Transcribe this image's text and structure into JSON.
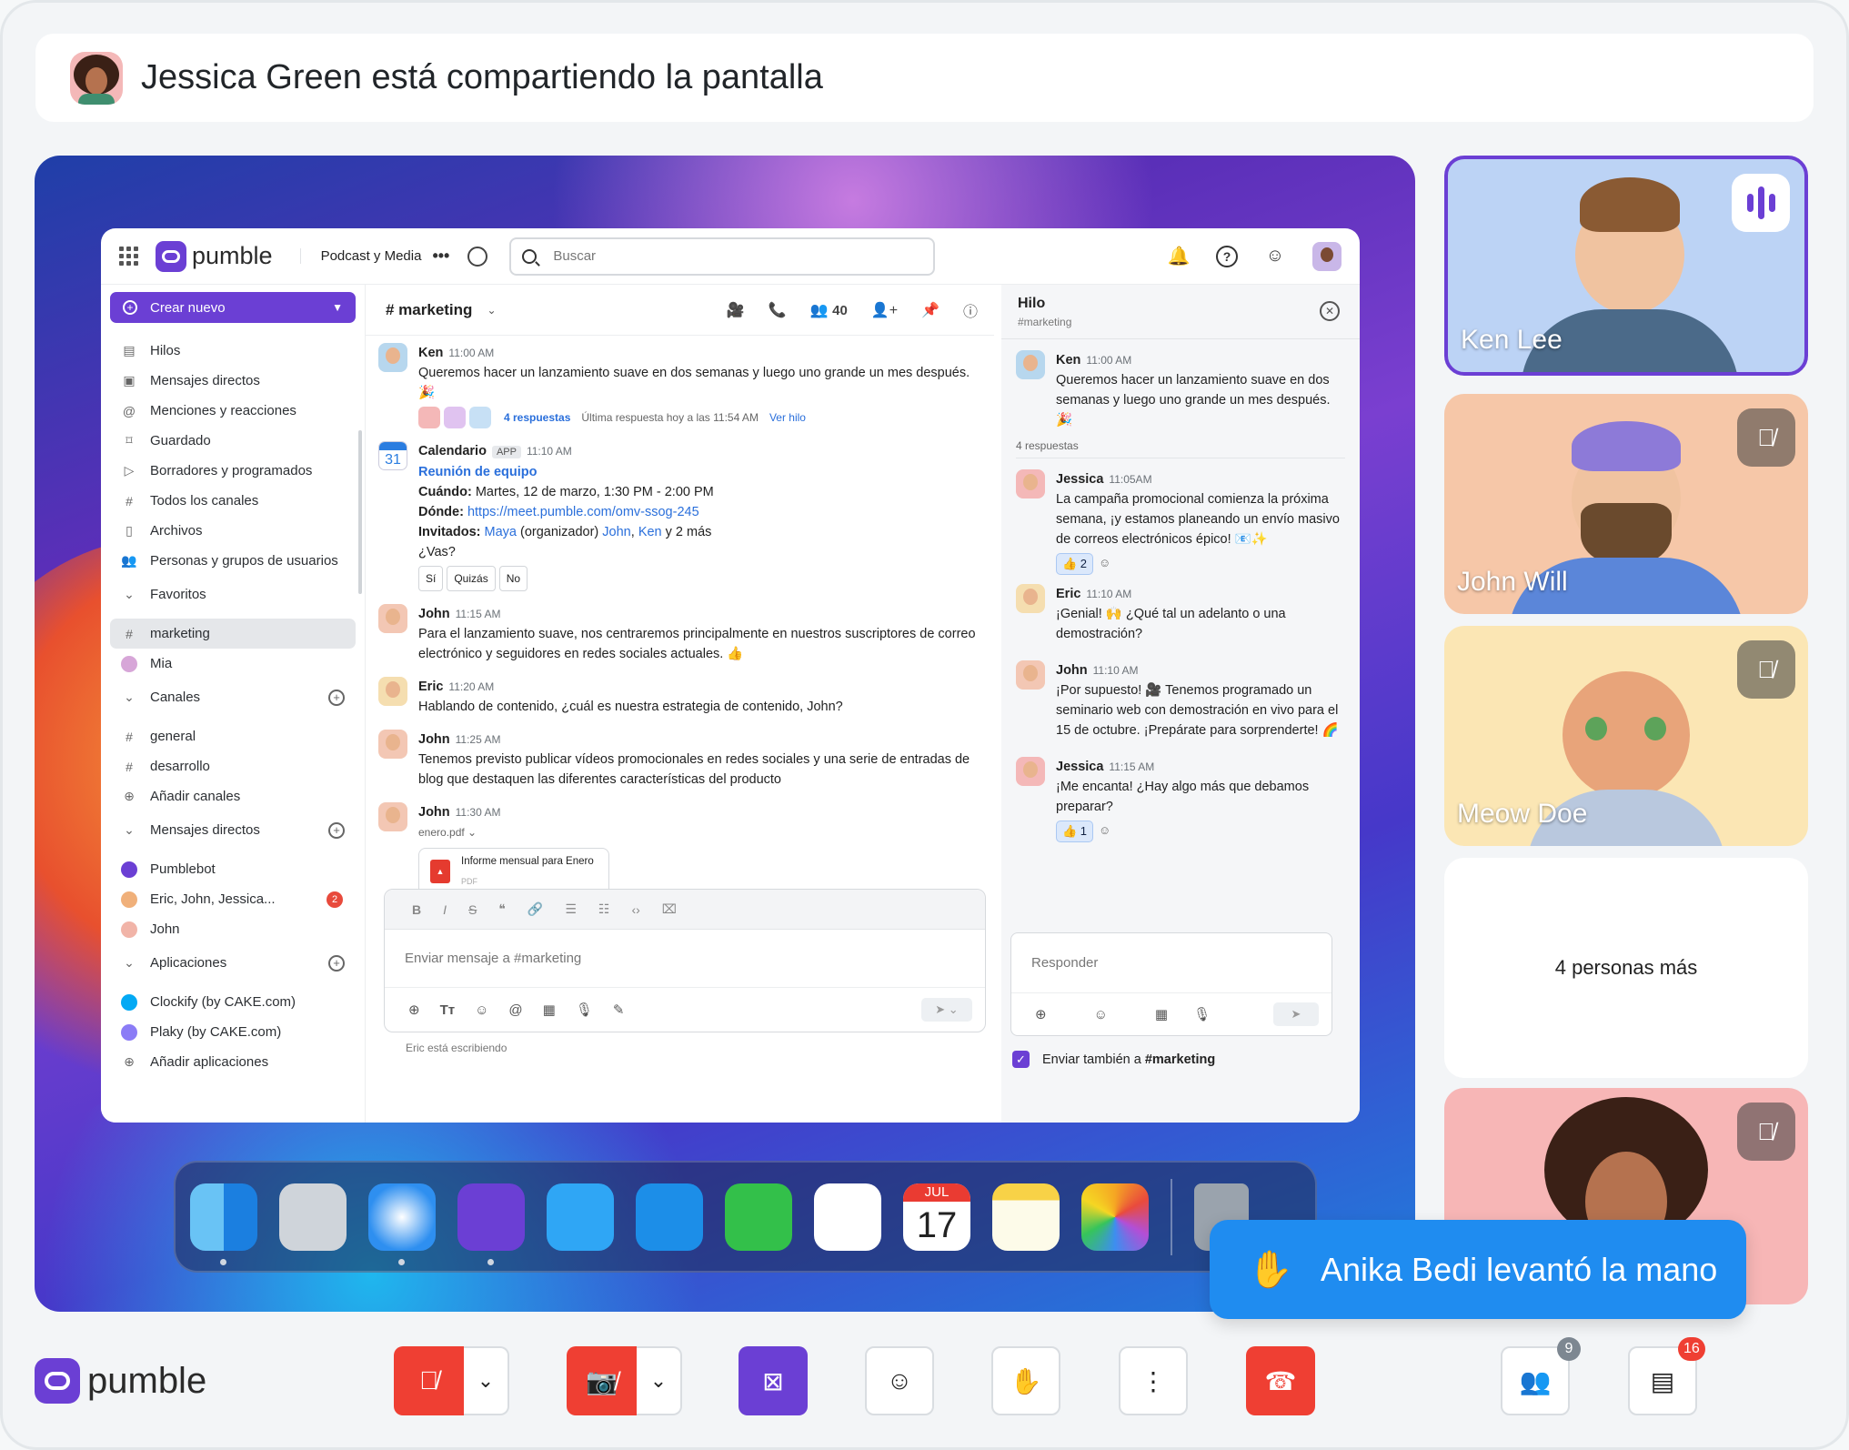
{
  "banner": {
    "text": "Jessica Green está compartiendo la pantalla"
  },
  "app": {
    "brand": "pumble",
    "workspace": "Podcast y Media",
    "search_placeholder": "Buscar"
  },
  "sidebar": {
    "create_label": "Crear nuevo",
    "items": [
      "Hilos",
      "Mensajes directos",
      "Menciones y reacciones",
      "Guardado",
      "Borradores y programados",
      "Todos los canales",
      "Archivos",
      "Personas y grupos de usuarios"
    ],
    "favorites_label": "Favoritos",
    "favorites": [
      "marketing",
      "Mia"
    ],
    "channels_label": "Canales",
    "channels": [
      "general",
      "desarrollo"
    ],
    "add_channels": "Añadir canales",
    "dms_label": "Mensajes directos",
    "dms": [
      "Pumblebot",
      "Eric, John, Jessica...",
      "John"
    ],
    "dm_badge": "2",
    "apps_label": "Aplicaciones",
    "apps": [
      "Clockify (by CAKE.com)",
      "Plaky (by CAKE.com)"
    ],
    "add_apps": "Añadir aplicaciones"
  },
  "channel": {
    "name": "# marketing",
    "members": "40",
    "messages": {
      "ken": {
        "name": "Ken",
        "time": "11:00 AM",
        "text": "Queremos hacer un lanzamiento suave en dos semanas y luego uno grande un mes después. 🎉",
        "replies": "4 respuestas",
        "last": "Última respuesta hoy a las 11:54 AM",
        "view": "Ver hilo"
      },
      "cal": {
        "name": "Calendario",
        "tag": "APP",
        "time": "11:10 AM",
        "event": "Reunión de equipo",
        "when_label": "Cuándo:",
        "when": "Martes, 12 de marzo, 1:30 PM - 2:00 PM",
        "where_label": "Dónde:",
        "where": "https://meet.pumble.com/omv-ssog-245",
        "guests_label": "Invitados:",
        "guest1": "Maya",
        "organizer": "(organizador)",
        "guest2": "John",
        "guest3": "Ken",
        "more": "y 2 más",
        "question": "¿Vas?",
        "opt1": "Sí",
        "opt2": "Quizás",
        "opt3": "No",
        "day": "31"
      },
      "john1": {
        "name": "John",
        "time": "11:15 AM",
        "text": "Para el lanzamiento suave, nos centraremos principalmente en nuestros suscriptores de correo electrónico y seguidores en redes sociales actuales. 👍"
      },
      "eric": {
        "name": "Eric",
        "time": "11:20 AM",
        "text": "Hablando de contenido, ¿cuál es nuestra estrategia de contenido, John?"
      },
      "john2": {
        "name": "John",
        "time": "11:25 AM",
        "text": "Tenemos previsto publicar vídeos promocionales en redes sociales y una serie de entradas de blog que destaquen las diferentes características del producto"
      },
      "john3": {
        "name": "John",
        "time": "11:30 AM",
        "file": "enero.pdf",
        "file_title": "Informe mensual para Enero",
        "file_type": "PDF"
      }
    },
    "composer_placeholder": "Enviar mensaje a #marketing",
    "typing": "Eric está escribiendo"
  },
  "thread": {
    "title": "Hilo",
    "subtitle": "#marketing",
    "ken": {
      "name": "Ken",
      "time": "11:00 AM",
      "text": "Queremos hacer un lanzamiento suave en dos semanas y luego uno grande un mes después. 🎉"
    },
    "count": "4 respuestas",
    "jessica1": {
      "name": "Jessica",
      "time": "11:05AM",
      "text": "La campaña promocional comienza la próxima semana, ¡y estamos planeando un envío masivo de correos electrónicos épico! 📧✨",
      "reaction": "👍 2"
    },
    "eric": {
      "name": "Eric",
      "time": "11:10 AM",
      "text": "¡Genial! 🙌 ¿Qué tal un adelanto o una demostración?"
    },
    "john": {
      "name": "John",
      "time": "11:10 AM",
      "text": "¡Por supuesto! 🎥 Tenemos programado un seminario web con demostración en vivo para el 15 de octubre. ¡Prepárate para sorprenderte! 🌈"
    },
    "jessica2": {
      "name": "Jessica",
      "time": "11:15 AM",
      "text": "¡Me encanta! ¿Hay algo más que debamos preparar?",
      "reaction": "👍 1"
    },
    "reply_placeholder": "Responder",
    "also_send": "Enviar también a",
    "also_channel": "#marketing"
  },
  "dock": {
    "calendar_month": "JUL",
    "calendar_day": "17"
  },
  "participants": [
    "Ken Lee",
    "John Will",
    "Meow Doe"
  ],
  "more_people": "4 personas más",
  "raised_hand": "Anika Bedi levantó la mano",
  "controls": {
    "brand": "pumble",
    "participants_badge": "9",
    "chat_badge": "16"
  },
  "colors": {
    "accent": "#6b3fd4",
    "danger": "#ef3f33",
    "toast": "#1f8cf0"
  }
}
